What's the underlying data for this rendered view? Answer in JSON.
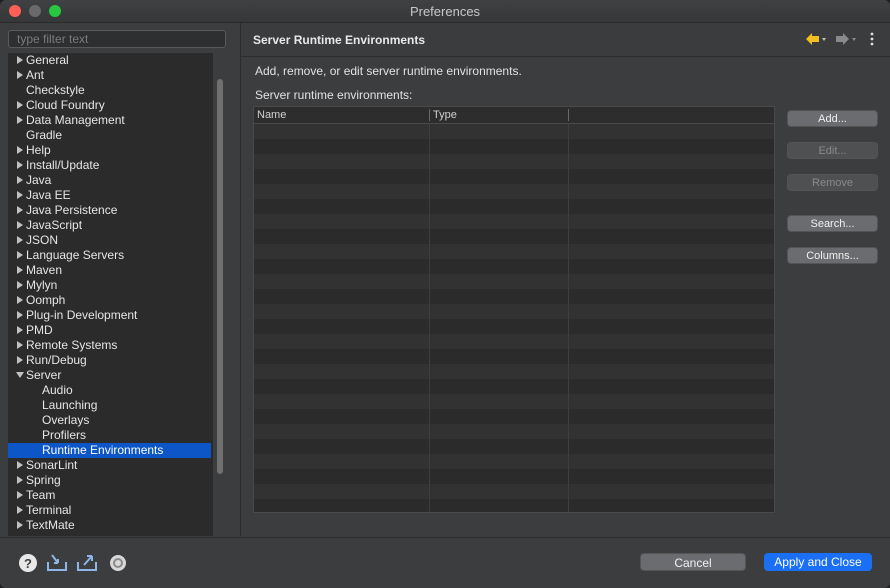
{
  "window": {
    "title": "Preferences"
  },
  "filter": {
    "placeholder": "type filter text"
  },
  "tree": [
    {
      "label": "General",
      "arrow": "right",
      "level": 0
    },
    {
      "label": "Ant",
      "arrow": "right",
      "level": 0
    },
    {
      "label": "Checkstyle",
      "arrow": "none",
      "level": 0
    },
    {
      "label": "Cloud Foundry",
      "arrow": "right",
      "level": 0
    },
    {
      "label": "Data Management",
      "arrow": "right",
      "level": 0
    },
    {
      "label": "Gradle",
      "arrow": "none",
      "level": 0
    },
    {
      "label": "Help",
      "arrow": "right",
      "level": 0
    },
    {
      "label": "Install/Update",
      "arrow": "right",
      "level": 0
    },
    {
      "label": "Java",
      "arrow": "right",
      "level": 0
    },
    {
      "label": "Java EE",
      "arrow": "right",
      "level": 0
    },
    {
      "label": "Java Persistence",
      "arrow": "right",
      "level": 0
    },
    {
      "label": "JavaScript",
      "arrow": "right",
      "level": 0
    },
    {
      "label": "JSON",
      "arrow": "right",
      "level": 0
    },
    {
      "label": "Language Servers",
      "arrow": "right",
      "level": 0
    },
    {
      "label": "Maven",
      "arrow": "right",
      "level": 0
    },
    {
      "label": "Mylyn",
      "arrow": "right",
      "level": 0
    },
    {
      "label": "Oomph",
      "arrow": "right",
      "level": 0
    },
    {
      "label": "Plug-in Development",
      "arrow": "right",
      "level": 0
    },
    {
      "label": "PMD",
      "arrow": "right",
      "level": 0
    },
    {
      "label": "Remote Systems",
      "arrow": "right",
      "level": 0
    },
    {
      "label": "Run/Debug",
      "arrow": "right",
      "level": 0
    },
    {
      "label": "Server",
      "arrow": "down",
      "level": 0
    },
    {
      "label": "Audio",
      "arrow": "none",
      "level": 1
    },
    {
      "label": "Launching",
      "arrow": "none",
      "level": 1
    },
    {
      "label": "Overlays",
      "arrow": "none",
      "level": 1
    },
    {
      "label": "Profilers",
      "arrow": "none",
      "level": 1
    },
    {
      "label": "Runtime Environments",
      "arrow": "none",
      "level": 1,
      "selected": true
    },
    {
      "label": "SonarLint",
      "arrow": "right",
      "level": 0
    },
    {
      "label": "Spring",
      "arrow": "right",
      "level": 0
    },
    {
      "label": "Team",
      "arrow": "right",
      "level": 0
    },
    {
      "label": "Terminal",
      "arrow": "right",
      "level": 0
    },
    {
      "label": "TextMate",
      "arrow": "right",
      "level": 0
    }
  ],
  "page": {
    "title": "Server Runtime Environments",
    "description": "Add, remove, or edit server runtime environments.",
    "table_label": "Server runtime environments:",
    "columns": [
      "Name",
      "Type"
    ]
  },
  "buttons": {
    "add": "Add...",
    "edit": "Edit...",
    "remove": "Remove",
    "search": "Search...",
    "columns": "Columns..."
  },
  "footer": {
    "cancel": "Cancel",
    "apply_close": "Apply and Close"
  },
  "colors": {
    "accent": "#1a6ff5",
    "selection": "#0d56c8",
    "nav_back_arrow": "#f0c020"
  },
  "icons": {
    "nav_back": "back-arrow-icon",
    "nav_forward": "forward-arrow-icon",
    "menu": "vertical-dots-icon",
    "help": "help-icon",
    "import": "import-icon",
    "export": "export-icon",
    "record": "record-icon"
  }
}
